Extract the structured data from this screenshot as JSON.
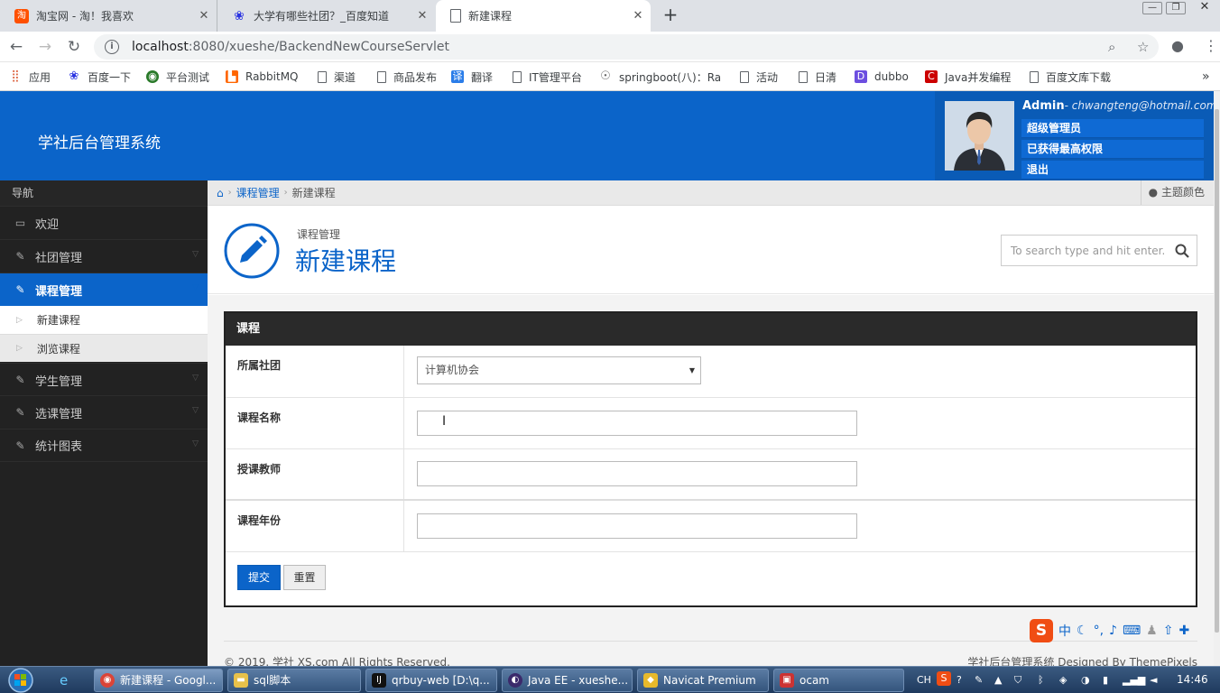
{
  "browser": {
    "tabs": [
      {
        "title": "淘宝网 - 淘！我喜欢",
        "close": "✕"
      },
      {
        "title": "大学有哪些社团？_百度知道",
        "close": "✕"
      },
      {
        "title": "新建课程",
        "close": "✕"
      }
    ],
    "new_tab": "+",
    "url_host": "localhost",
    "url_rest": ":8080/xueshe/BackendNewCourseServlet",
    "bookmarks": [
      "应用",
      "百度一下",
      "平台测试",
      "RabbitMQ",
      "渠道",
      "商品发布",
      "翻译",
      "IT管理平台",
      "springboot(八)：Ra",
      "活动",
      "日清",
      "dubbo",
      "Java并发编程",
      "百度文库下载"
    ],
    "more": "»"
  },
  "app": {
    "brand": "学社后台管理系统",
    "user": {
      "name": "Admin",
      "email": "- chwangteng@hotmail.com",
      "links": [
        "超级管理员",
        "已获得最高权限",
        "退出"
      ]
    },
    "sidebar": {
      "header": "导航",
      "items": [
        {
          "label": "欢迎"
        },
        {
          "label": "社团管理"
        },
        {
          "label": "课程管理"
        },
        {
          "label": "学生管理"
        },
        {
          "label": "选课管理"
        },
        {
          "label": "统计图表"
        }
      ],
      "sub_items": [
        "新建课程",
        "浏览课程"
      ]
    },
    "breadcrumb": {
      "section": "课程管理",
      "current": "新建课程",
      "theme": "主题颜色"
    },
    "page": {
      "subtitle": "课程管理",
      "title": "新建课程",
      "search_placeholder": "To search type and hit enter..."
    },
    "form": {
      "panel_title": "课程",
      "club_label": "所属社团",
      "club_value": "计算机协会",
      "name_label": "课程名称",
      "teacher_label": "授课教师",
      "year_label": "课程年份",
      "submit": "提交",
      "reset": "重置"
    },
    "footer": {
      "left": "© 2019. 学社 XS.com All Rights Reserved.",
      "right": "学社后台管理系统  Designed By ThemePixels"
    }
  },
  "taskbar": {
    "items": [
      {
        "label": "新建课程 - Googl..."
      },
      {
        "label": "sql脚本"
      },
      {
        "label": "qrbuy-web [D:\\q..."
      },
      {
        "label": "Java EE - xueshe..."
      },
      {
        "label": "Navicat Premium"
      },
      {
        "label": "ocam"
      }
    ],
    "lang": "CH",
    "time": "14:46"
  },
  "ime": {
    "logo": "S",
    "mode": "中"
  },
  "colors": {
    "primary": "#0b64c9",
    "sidebar": "#222222",
    "panel_header": "#2a2a2a"
  }
}
